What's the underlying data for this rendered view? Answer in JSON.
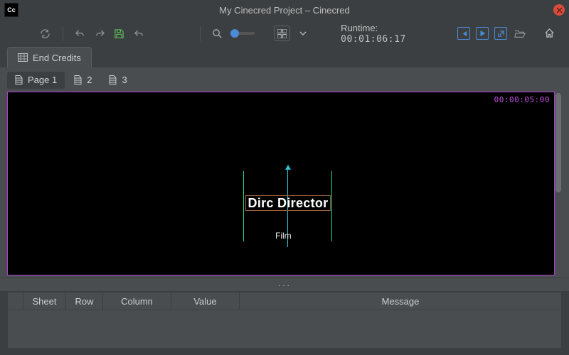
{
  "titlebar": {
    "title": "My Cinecred Project – Cinecred",
    "app_icon_label": "Cc"
  },
  "toolbar": {
    "runtime_label": "Runtime:",
    "runtime_tc": "00:01:06:17"
  },
  "main_tab": {
    "label": "End Credits"
  },
  "pages": [
    {
      "label": "Page 1",
      "active": true
    },
    {
      "label": "2",
      "active": false
    },
    {
      "label": "3",
      "active": false
    }
  ],
  "preview": {
    "timecode": "00:00:05:00",
    "role_text": "Dirc Director",
    "sub_text": "Film"
  },
  "more_dots": "···",
  "table": {
    "cols": [
      "Sheet",
      "Row",
      "Column",
      "Value",
      "Message"
    ]
  }
}
